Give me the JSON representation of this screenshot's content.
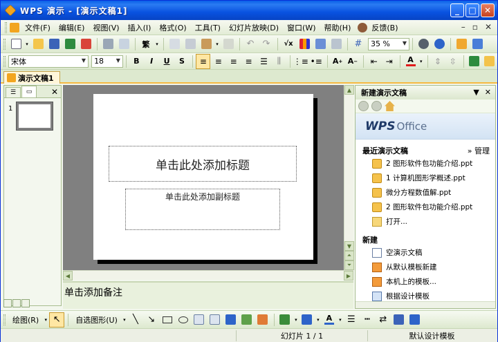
{
  "window": {
    "title": "WPS 演示 - [演示文稿1]"
  },
  "menu": {
    "items": [
      "文件(F)",
      "编辑(E)",
      "视图(V)",
      "插入(I)",
      "格式(O)",
      "工具(T)",
      "幻灯片放映(D)",
      "窗口(W)",
      "帮助(H)",
      "反馈(B)"
    ]
  },
  "toolbar": {
    "zoom": "35 %",
    "font_name": "宋体",
    "font_size": "18",
    "simplified_label": "繁",
    "bold": "B",
    "italic": "I",
    "underline": "U",
    "shadow": "S"
  },
  "doc_tab": {
    "label": "演示文稿1"
  },
  "slide_pane": {
    "slide_number": "1"
  },
  "slide": {
    "title_placeholder": "单击此处添加标题",
    "subtitle_placeholder": "单击此处添加副标题"
  },
  "notes": {
    "placeholder": "单击添加备注"
  },
  "taskpane": {
    "title": "新建演示文稿",
    "brand_main": "WPS",
    "brand_sub": "Office",
    "recent_heading": "最近演示文稿",
    "manage_label": "» 管理",
    "recent_files": [
      "2 图形软件包功能介绍.ppt",
      "1 计算机图形学概述.ppt",
      "微分方程数值解.ppt",
      "2 图形软件包功能介绍.ppt"
    ],
    "open_label": "打开...",
    "new_heading": "新建",
    "new_items": [
      "空演示文稿",
      "从默认模板新建",
      "本机上的模板...",
      "根据设计模板"
    ]
  },
  "drawbar": {
    "draw_label": "绘图(R)",
    "autoshapes_label": "自选图形(U)"
  },
  "status": {
    "slide_indicator": "幻灯片 1 / 1",
    "template": "默认设计模板"
  },
  "colors": {
    "titlebar": "#0A5FE8",
    "toolbar_bg": "#DDE9CF",
    "active_tab_accent": "#F6B941",
    "canvas_bg": "#808080",
    "font_color_swatch": "#E01B1B"
  }
}
